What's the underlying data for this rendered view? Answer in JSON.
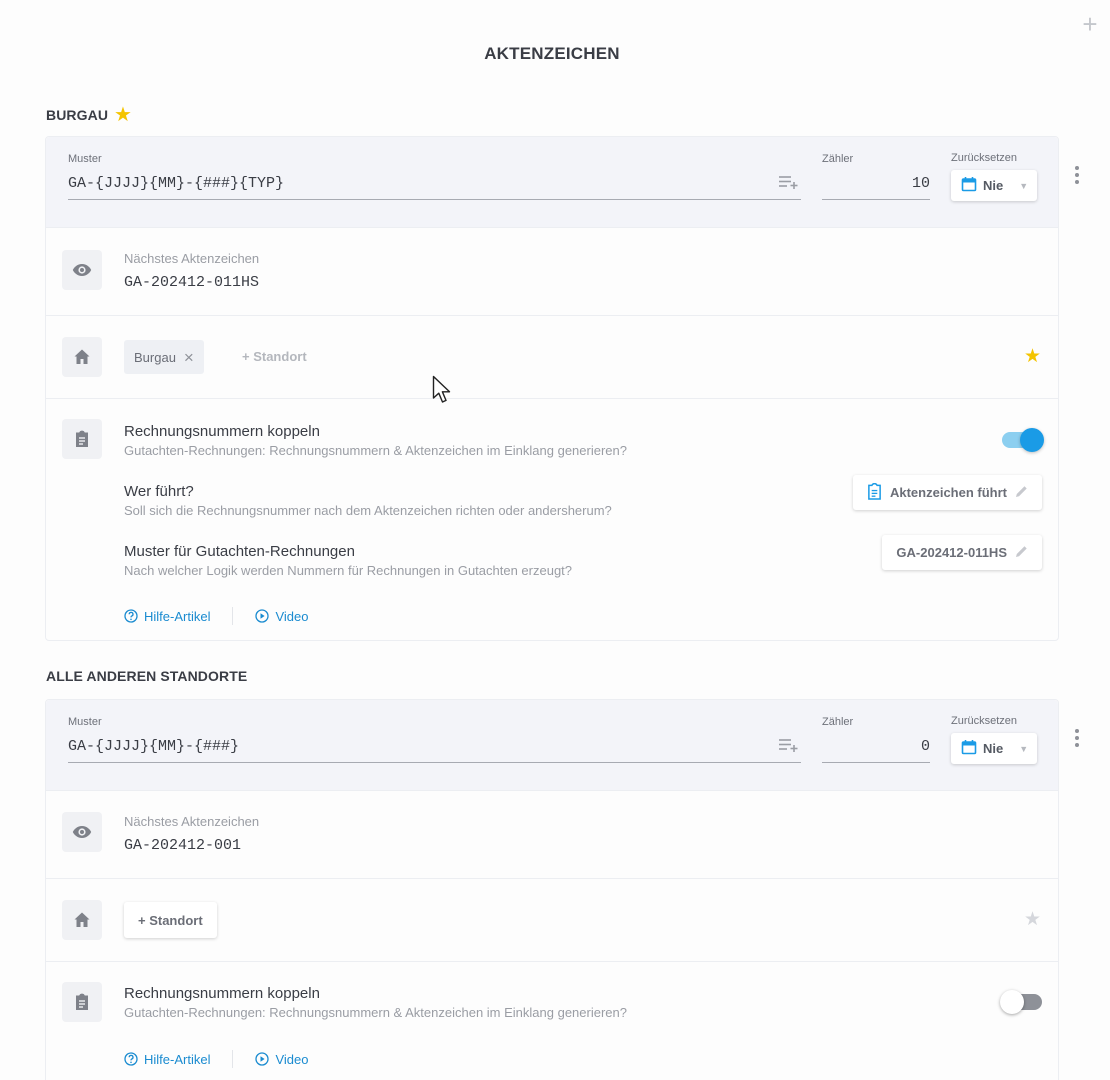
{
  "page": {
    "title": "AKTENZEICHEN"
  },
  "groups": [
    {
      "heading": "BURGAU",
      "favorite": true,
      "pattern_label": "Muster",
      "pattern": "GA-{JJJJ}{MM}-{###}{TYP}",
      "counter_label": "Zähler",
      "counter": "10",
      "reset_label": "Zurücksetzen",
      "reset_value": "Nie",
      "next_label": "Nächstes Aktenzeichen",
      "next_value": "GA-202412-011HS",
      "location_chip": "Burgau",
      "add_location": "+ Standort",
      "couple_title": "Rechnungsnummern koppeln",
      "couple_desc": "Gutachten-Rechnungen: Rechnungsnummern & Aktenzeichen im Einklang generieren?",
      "couple_enabled": true,
      "leader_title": "Wer führt?",
      "leader_desc": "Soll sich die Rechnungsnummer nach dem Aktenzeichen richten oder andersherum?",
      "leader_button": "Aktenzeichen führt",
      "invoice_title": "Muster für Gutachten-Rechnungen",
      "invoice_desc": "Nach welcher Logik werden Nummern für Rechnungen in Gutachten erzeugt?",
      "invoice_button": "GA-202412-011HS",
      "help_link": "Hilfe-Artikel",
      "video_link": "Video"
    },
    {
      "heading": "ALLE ANDEREN STANDORTE",
      "favorite": false,
      "pattern_label": "Muster",
      "pattern": "GA-{JJJJ}{MM}-{###}",
      "counter_label": "Zähler",
      "counter": "0",
      "reset_label": "Zurücksetzen",
      "reset_value": "Nie",
      "next_label": "Nächstes Aktenzeichen",
      "next_value": "GA-202412-001",
      "add_location": "+ Standort",
      "couple_title": "Rechnungsnummern koppeln",
      "couple_desc": "Gutachten-Rechnungen: Rechnungsnummern & Aktenzeichen im Einklang generieren?",
      "couple_enabled": false,
      "help_link": "Hilfe-Artikel",
      "video_link": "Video"
    }
  ],
  "colors": {
    "accent": "#1a9be6",
    "star": "#f4c400",
    "star_inactive": "#d5d7dc",
    "link": "#1a8bd0"
  }
}
